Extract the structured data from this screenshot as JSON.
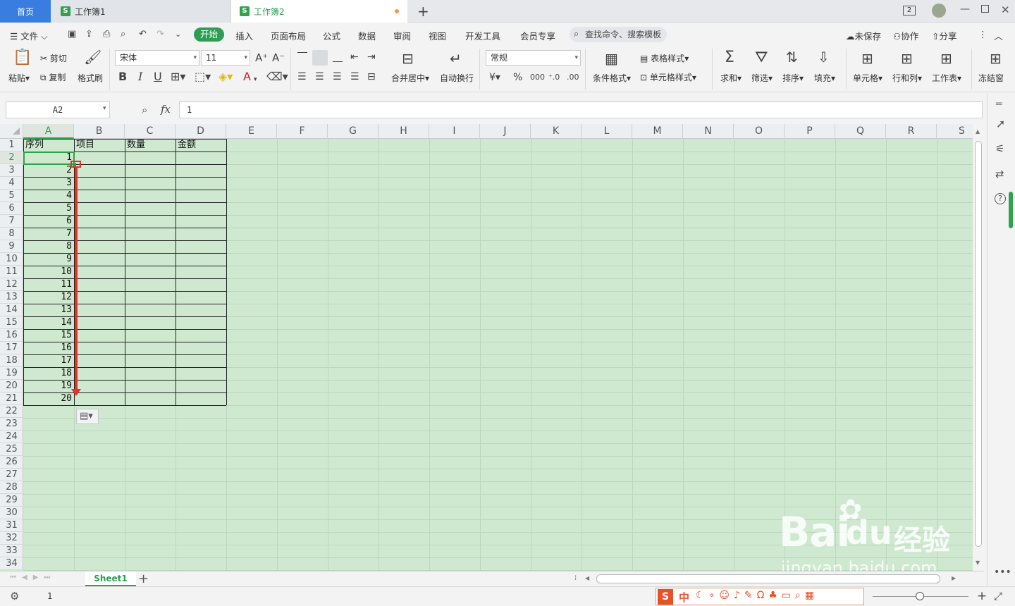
{
  "tabs": {
    "home": "首页",
    "book1": "工作簿1",
    "book2": "工作簿2",
    "new_tab": "+"
  },
  "window": {
    "badge": "2"
  },
  "menu": {
    "file": "文件",
    "items": [
      "开始",
      "插入",
      "页面布局",
      "公式",
      "数据",
      "审阅",
      "视图",
      "开发工具",
      "会员专享"
    ],
    "search": "查找命令、搜索模板",
    "unsaved": "未保存",
    "collab": "协作",
    "share": "分享"
  },
  "ribbon": {
    "paste": "粘贴",
    "cut": "剪切",
    "copy": "复制",
    "format_painter": "格式刷",
    "font_name": "宋体",
    "font_size": "11",
    "merge_center": "合并居中",
    "wrap_text": "自动换行",
    "number_format": "常规",
    "conditional": "条件格式",
    "table_style": "表格样式",
    "cell_style": "单元格样式",
    "sum": "求和",
    "filter": "筛选",
    "sort": "排序",
    "fill": "填充",
    "cell": "单元格",
    "row_col": "行和列",
    "worksheet": "工作表",
    "freeze": "冻结窗",
    "bold": "B",
    "italic": "I",
    "underline": "U",
    "font_color": "A"
  },
  "formula_bar": {
    "name_box": "A2",
    "fx": "fx",
    "value": "1"
  },
  "columns": [
    "A",
    "B",
    "C",
    "D",
    "E",
    "F",
    "G",
    "H",
    "I",
    "J",
    "K",
    "L",
    "M",
    "N",
    "O",
    "P",
    "Q",
    "R",
    "S"
  ],
  "row_count": 34,
  "headers": [
    "序列",
    "项目",
    "数量",
    "金额"
  ],
  "sequence": [
    "1",
    "2",
    "3",
    "4",
    "5",
    "6",
    "7",
    "8",
    "9",
    "10",
    "11",
    "12",
    "13",
    "14",
    "15",
    "16",
    "17",
    "18",
    "19",
    "20"
  ],
  "sheet_tab": "Sheet1",
  "status": {
    "value": "1"
  },
  "watermark": {
    "brand": "Bai",
    "du": "du",
    "cn": "经验",
    "url": "jingyan.baidu.com"
  },
  "ime": {
    "lang": "中"
  },
  "colors": {
    "accent_green": "#2d9e53",
    "sheet_bg": "#cfe8d0",
    "active_border": "#2fa14f",
    "arrow": "#e8302a"
  }
}
